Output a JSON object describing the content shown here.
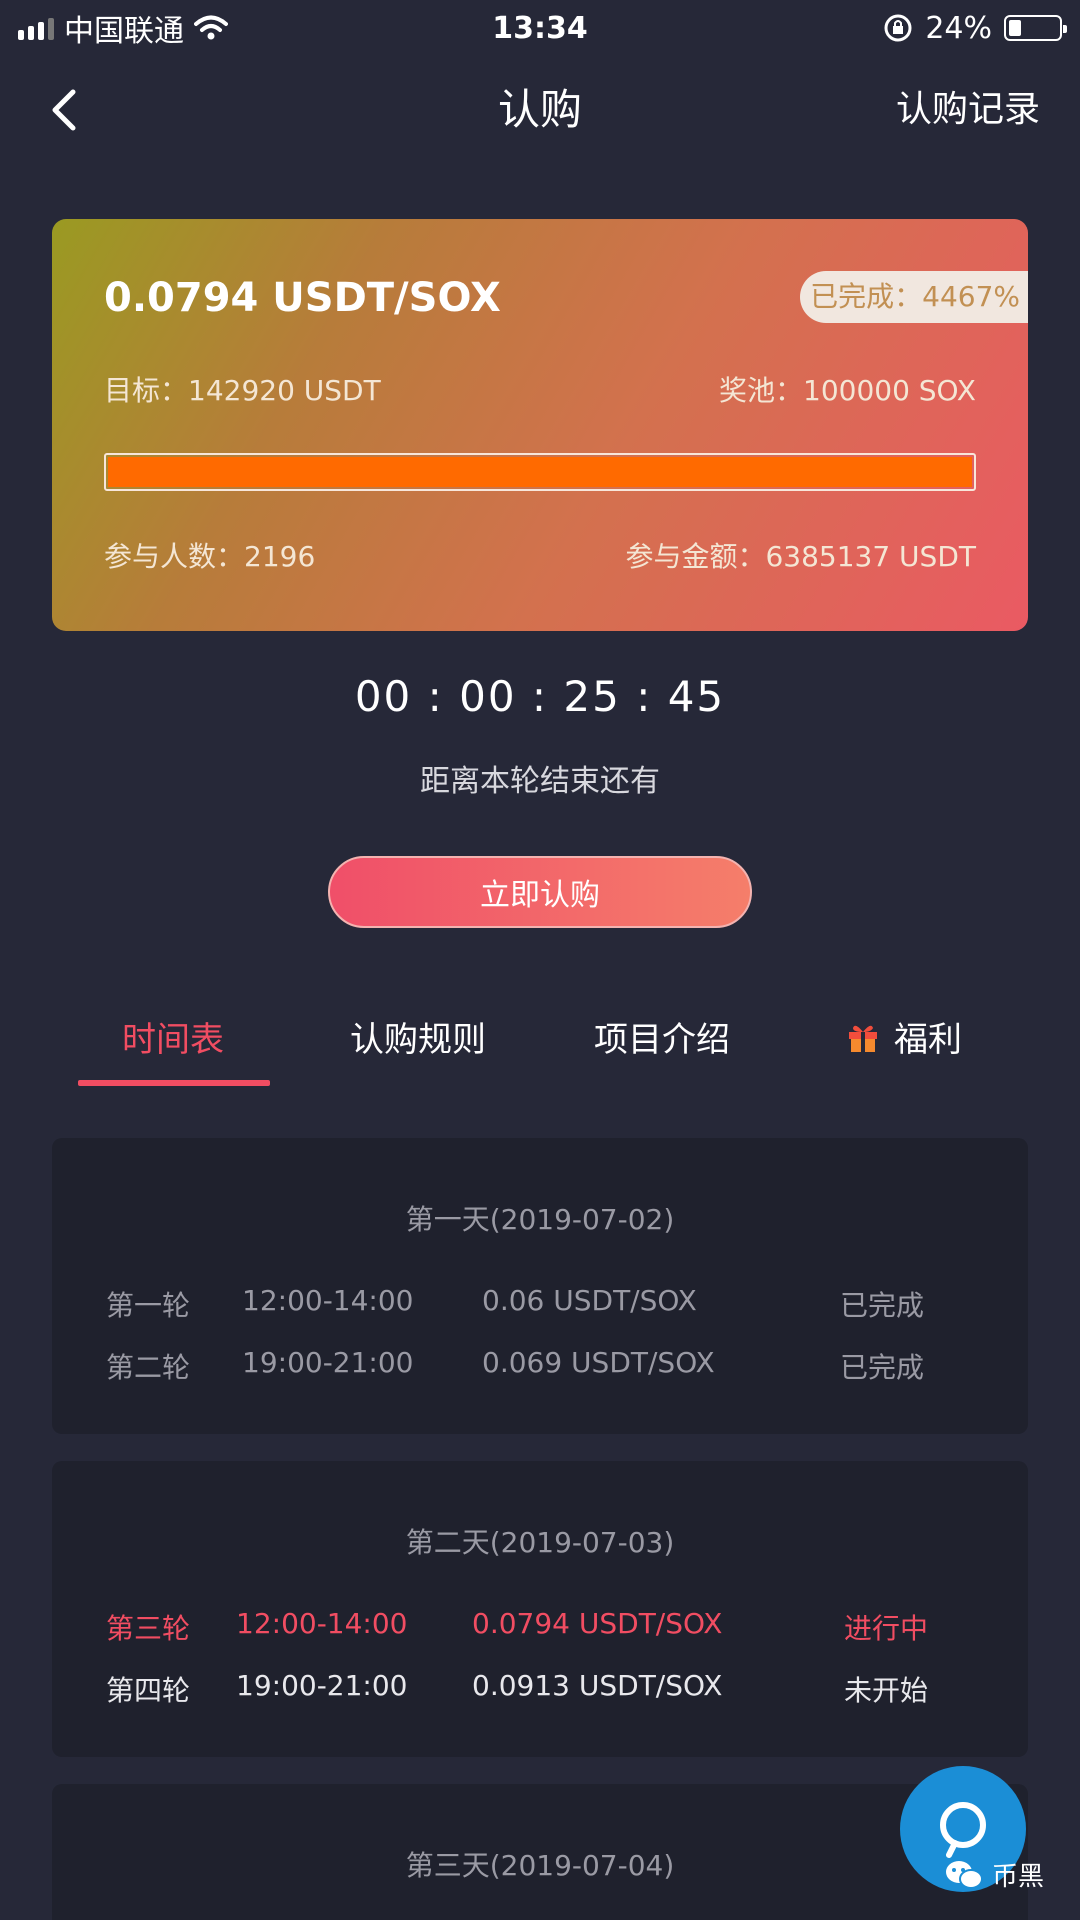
{
  "status_bar": {
    "carrier": "中国联通",
    "time": "13:34",
    "battery": "24%",
    "battery_level": 0.24
  },
  "nav": {
    "title": "认购",
    "records_link": "认购记录"
  },
  "summary": {
    "price": "0.0794 USDT/SOX",
    "completion": "已完成：4467%",
    "target": "目标：142920 USDT",
    "pool": "奖池：100000 SOX",
    "progress": 1.0,
    "participants": "参与人数：2196",
    "amount": "参与金额：6385137 USDT",
    "progress_color": "#ff6a00"
  },
  "countdown": {
    "time": "00 : 00 : 25 : 45",
    "label": "距离本轮结束还有"
  },
  "actions": {
    "subscribe": "立即认购"
  },
  "tabs": [
    {
      "label": "时间表",
      "active": true
    },
    {
      "label": "认购规则",
      "active": false
    },
    {
      "label": "项目介绍",
      "active": false
    },
    {
      "label": "福利",
      "active": false,
      "icon": "gift-icon"
    }
  ],
  "schedule": [
    {
      "title": "第一天(2019-07-02)",
      "rounds": [
        {
          "name": "第一轮",
          "time": "12:00-14:00",
          "price": "0.06 USDT/SOX",
          "status": "已完成"
        },
        {
          "name": "第二轮",
          "time": "19:00-21:00",
          "price": "0.069 USDT/SOX",
          "status": "已完成"
        }
      ]
    },
    {
      "title": "第二天(2019-07-03)",
      "rounds": [
        {
          "name": "第三轮",
          "time": "12:00-14:00",
          "price": "0.0794 USDT/SOX",
          "status": "进行中"
        },
        {
          "name": "第四轮",
          "time": "19:00-21:00",
          "price": "0.0913 USDT/SOX",
          "status": "未开始"
        }
      ]
    },
    {
      "title": "第三天(2019-07-04)",
      "rounds": []
    }
  ],
  "watermark": "币黑",
  "colors": {
    "accent": "#f14d62",
    "background": "#262838",
    "panel": "#1f212d"
  }
}
